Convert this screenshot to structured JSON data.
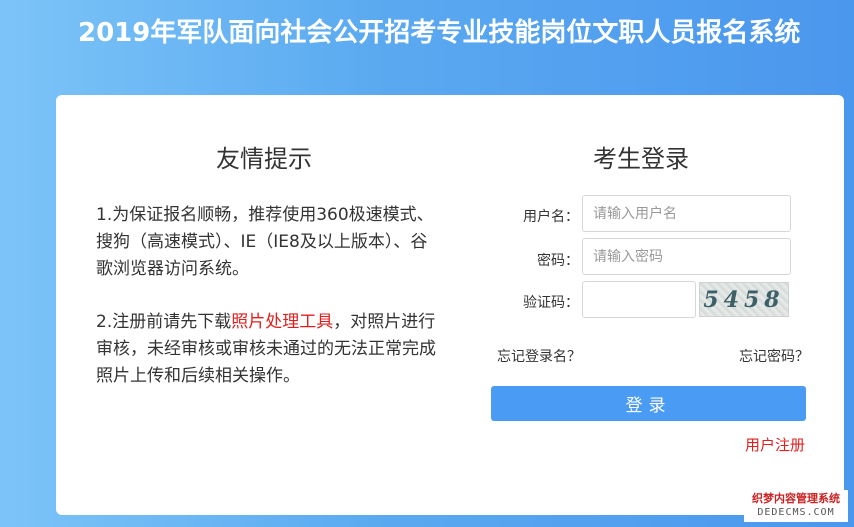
{
  "header": {
    "title": "2019年军队面向社会公开招考专业技能岗位文职人员报名系统"
  },
  "tips": {
    "heading": "友情提示",
    "p1": "1.为保证报名顺畅，推荐使用360极速模式、搜狗（高速模式）、IE（IE8及以上版本）、谷歌浏览器访问系统。",
    "p2_before": "2.注册前请先下载",
    "p2_link": "照片处理工具",
    "p2_after": "，对照片进行审核，未经审核或审核未通过的无法正常完成照片上传和后续相关操作。"
  },
  "login": {
    "heading": "考生登录",
    "username_label": "用户名：",
    "username_placeholder": "请输入用户名",
    "password_label": "密码：",
    "password_placeholder": "请输入密码",
    "captcha_label": "验证码：",
    "captcha_text": "5458",
    "forgot_username": "忘记登录名？",
    "forgot_password": "忘记密码？",
    "submit_label": "登录",
    "register_label": "用户注册"
  },
  "watermark": {
    "line1": "织梦内容管理系统",
    "line2": "DEDECMS.COM"
  },
  "colors": {
    "accent": "#4a9bf4",
    "link_red": "#e02020"
  }
}
